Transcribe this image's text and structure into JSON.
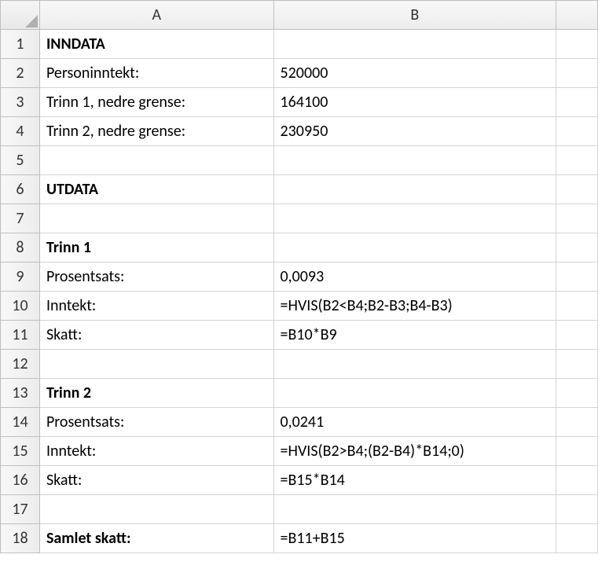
{
  "columns": {
    "A": "A",
    "B": "B"
  },
  "rows": {
    "1": {
      "num": "1",
      "A": "INNDATA",
      "B": "",
      "A_bold": true
    },
    "2": {
      "num": "2",
      "A": "Personinntekt:",
      "B": "520000"
    },
    "3": {
      "num": "3",
      "A": "Trinn 1, nedre grense:",
      "B": "164100"
    },
    "4": {
      "num": "4",
      "A": "Trinn 2, nedre grense:",
      "B": "230950"
    },
    "5": {
      "num": "5",
      "A": "",
      "B": ""
    },
    "6": {
      "num": "6",
      "A": "UTDATA",
      "B": "",
      "A_bold": true
    },
    "7": {
      "num": "7",
      "A": "",
      "B": ""
    },
    "8": {
      "num": "8",
      "A": "Trinn 1",
      "B": "",
      "A_bold": true
    },
    "9": {
      "num": "9",
      "A": "Prosentsats:",
      "B": "0,0093"
    },
    "10": {
      "num": "10",
      "A": "Inntekt:",
      "B": "=HVIS(B2<B4;B2-B3;B4-B3)"
    },
    "11": {
      "num": "11",
      "A": "Skatt:",
      "B": "=B10*B9"
    },
    "12": {
      "num": "12",
      "A": "",
      "B": ""
    },
    "13": {
      "num": "13",
      "A": "Trinn 2",
      "B": "",
      "A_bold": true
    },
    "14": {
      "num": "14",
      "A": "Prosentsats:",
      "B": "0,0241"
    },
    "15": {
      "num": "15",
      "A": "Inntekt:",
      "B": "=HVIS(B2>B4;(B2-B4)*B14;0)"
    },
    "16": {
      "num": "16",
      "A": "Skatt:",
      "B": "=B15*B14"
    },
    "17": {
      "num": "17",
      "A": "",
      "B": ""
    },
    "18": {
      "num": "18",
      "A": "Samlet skatt:",
      "B": "=B11+B15",
      "A_bold": true
    }
  }
}
